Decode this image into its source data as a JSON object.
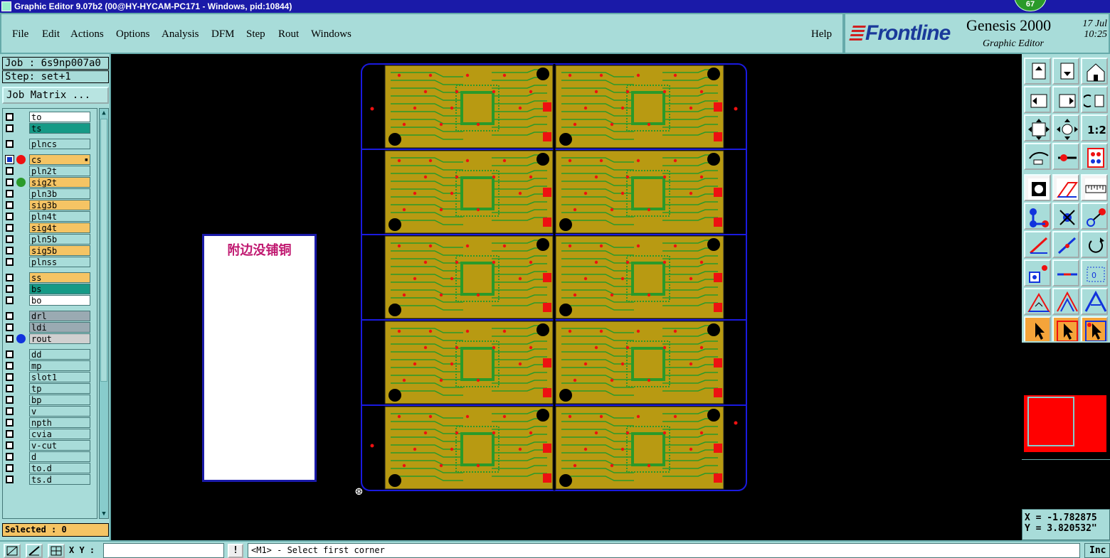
{
  "window": {
    "title": "Graphic Editor 9.07b2 (00@HY-HYCAM-PC171 - Windows, pid:10844)",
    "badge": "67"
  },
  "menu": {
    "file": "File",
    "edit": "Edit",
    "actions": "Actions",
    "options": "Options",
    "analysis": "Analysis",
    "dfm": "DFM",
    "step": "Step",
    "rout": "Rout",
    "windows": "Windows",
    "help": "Help"
  },
  "brand": {
    "logo": "Frontline",
    "product": "Genesis 2000",
    "subtitle": "Graphic Editor",
    "date": "17 Jul",
    "time": "10:25"
  },
  "panel": {
    "job": "Job : 6s9np007a0",
    "step": "Step: set+1",
    "job_matrix": "Job Matrix ...",
    "selected": "Selected : 0"
  },
  "layers": [
    {
      "name": "to",
      "bg": "#ffffff",
      "dot": null
    },
    {
      "name": "ts",
      "bg": "#169a86",
      "dot": null
    },
    {
      "name": "plncs",
      "bg": "#a8dcd9",
      "dot": null
    },
    {
      "name": "cs",
      "bg": "#f5c464",
      "dot": "#ee1111",
      "active": true
    },
    {
      "name": "pln2t",
      "bg": "#a8dcd9",
      "dot": null
    },
    {
      "name": "sig2t",
      "bg": "#f5c464",
      "dot": "#2a9a2a"
    },
    {
      "name": "pln3b",
      "bg": "#a8dcd9",
      "dot": null
    },
    {
      "name": "sig3b",
      "bg": "#f5c464",
      "dot": null
    },
    {
      "name": "pln4t",
      "bg": "#a8dcd9",
      "dot": null
    },
    {
      "name": "sig4t",
      "bg": "#f5c464",
      "dot": null
    },
    {
      "name": "pln5b",
      "bg": "#a8dcd9",
      "dot": null
    },
    {
      "name": "sig5b",
      "bg": "#f5c464",
      "dot": null
    },
    {
      "name": "plnss",
      "bg": "#a8dcd9",
      "dot": null
    },
    {
      "name": "ss",
      "bg": "#f5c464",
      "dot": null
    },
    {
      "name": "bs",
      "bg": "#169a86",
      "dot": null
    },
    {
      "name": "bo",
      "bg": "#ffffff",
      "dot": null
    },
    {
      "name": "drl",
      "bg": "#9aaab2",
      "dot": null
    },
    {
      "name": "ldi",
      "bg": "#9aaab2",
      "dot": null
    },
    {
      "name": "rout",
      "bg": "#d0d0d0",
      "dot": "#1133dd"
    },
    {
      "name": "dd",
      "bg": "#a8dcd9",
      "dot": null
    },
    {
      "name": "mp",
      "bg": "#a8dcd9",
      "dot": null
    },
    {
      "name": "slot1",
      "bg": "#a8dcd9",
      "dot": null
    },
    {
      "name": "tp",
      "bg": "#a8dcd9",
      "dot": null
    },
    {
      "name": "bp",
      "bg": "#a8dcd9",
      "dot": null
    },
    {
      "name": "v",
      "bg": "#a8dcd9",
      "dot": null
    },
    {
      "name": "npth",
      "bg": "#a8dcd9",
      "dot": null
    },
    {
      "name": "cvia",
      "bg": "#a8dcd9",
      "dot": null
    },
    {
      "name": "v-cut",
      "bg": "#a8dcd9",
      "dot": null
    },
    {
      "name": "d",
      "bg": "#a8dcd9",
      "dot": null
    },
    {
      "name": "to.d",
      "bg": "#a8dcd9",
      "dot": null
    },
    {
      "name": "ts.d",
      "bg": "#a8dcd9",
      "dot": null
    }
  ],
  "canvas": {
    "note": "附边没铺铜",
    "panel_rows": 5,
    "panel_cols": 2
  },
  "tools": [
    "move-up-icon",
    "move-down-icon",
    "home-icon",
    "move-left-icon",
    "move-right-icon",
    "undo-view-icon",
    "zoom-fit-icon",
    "zoom-center-icon",
    "scale-1-2-icon",
    "snap-icon",
    "measure-icon",
    "layer-pads-icon",
    "fill-icon",
    "polygon-icon",
    "ruler-icon",
    "connect-icon",
    "delete-icon",
    "move-point-icon",
    "line-red-icon",
    "line-blue-icon",
    "rotate-icon",
    "copy-icon",
    "split-icon",
    "resize-icon",
    "angle-icon",
    "triangle-red-icon",
    "triangle-blue-icon",
    "select-icon",
    "select-box-icon",
    "select-point-icon"
  ],
  "coords": {
    "x": "X = -1.782875",
    "y": "Y = 3.820532\""
  },
  "bottom": {
    "xy_label": "X Y :",
    "xy_value": "",
    "warn": "!",
    "prompt": "<M1> - Select first corner",
    "units": "Inc"
  }
}
